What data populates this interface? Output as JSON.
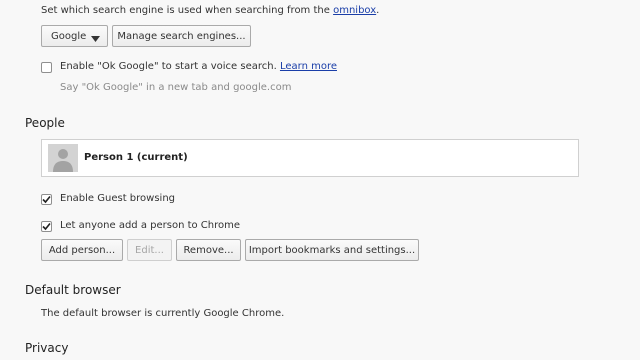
{
  "search": {
    "description_prefix": "Set which search engine is used when searching from the",
    "omnibox_link": "omnibox",
    "description_suffix": ".",
    "engine_value": "Google",
    "manage_button": "Manage search engines...",
    "ok_google_checked": false,
    "ok_google_label": "Enable \"Ok Google\" to start a voice search.",
    "learn_more_link": "Learn more",
    "ok_google_hint": "Say \"Ok Google\" in a new tab and google.com"
  },
  "people": {
    "title": "People",
    "person_name": "Person 1 (current)",
    "guest_checked": true,
    "guest_label": "Enable Guest browsing",
    "add_person_checked": true,
    "add_person_label": "Let anyone add a person to Chrome",
    "buttons": {
      "add": "Add person...",
      "edit": "Edit...",
      "remove": "Remove...",
      "import": "Import bookmarks and settings..."
    }
  },
  "default_browser": {
    "title": "Default browser",
    "status": "The default browser is currently Google Chrome."
  },
  "privacy": {
    "title": "Privacy"
  },
  "colors": {
    "link": "#1a3ea8",
    "background": "#f8f8f8",
    "muted_text": "#8a8a8a"
  }
}
